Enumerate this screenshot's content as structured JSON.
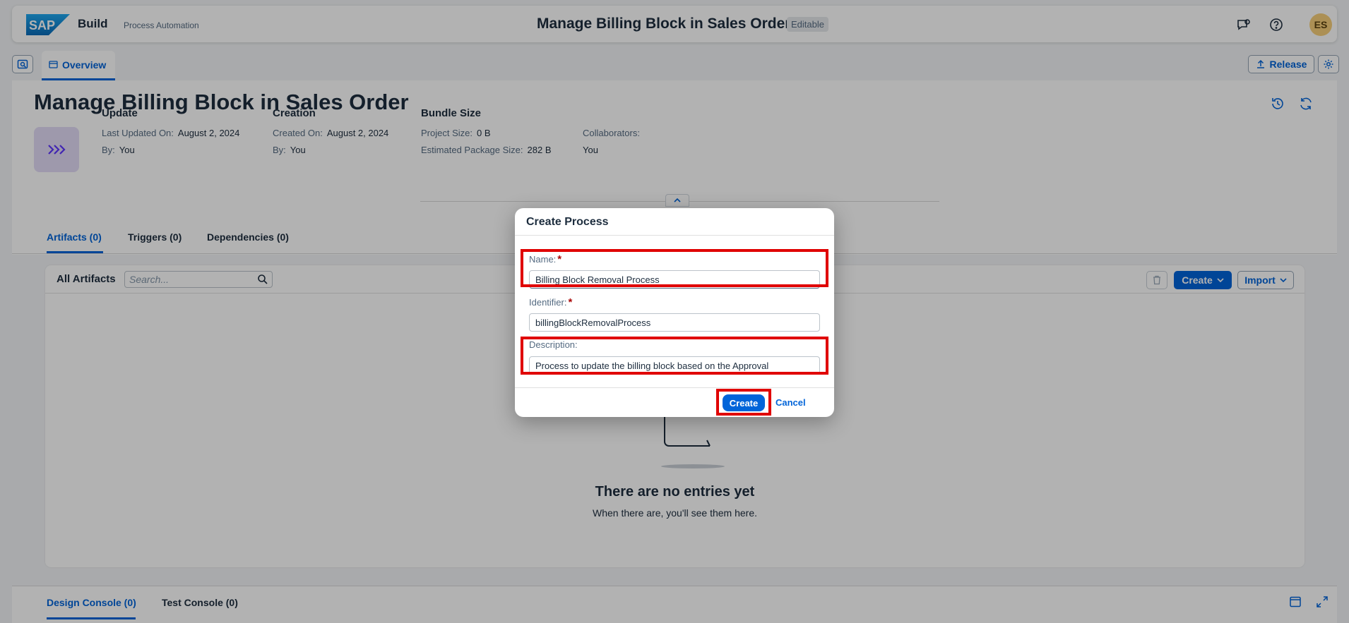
{
  "shell": {
    "logo_text": "SAP",
    "product": "Build",
    "product_sub": "Process Automation",
    "title": "Manage Billing Block in Sales Order",
    "badge": "Editable",
    "avatar_initials": "ES"
  },
  "subheader": {
    "overview_tab": "Overview",
    "release_label": "Release"
  },
  "project": {
    "title": "Manage Billing Block in Sales Order",
    "update": {
      "heading": "Update",
      "last_updated_label": "Last Updated On:",
      "last_updated_value": "August 2, 2024",
      "by_label": "By:",
      "by_value": "You"
    },
    "creation": {
      "heading": "Creation",
      "created_label": "Created On:",
      "created_value": "August 2, 2024",
      "by_label": "By:",
      "by_value": "You"
    },
    "bundle": {
      "heading": "Bundle Size",
      "project_size_label": "Project Size:",
      "project_size_value": "0 B",
      "package_size_label": "Estimated Package Size:",
      "package_size_value": "282 B",
      "collaborators_label": "Collaborators:",
      "collaborators_value": "You"
    }
  },
  "tabs": [
    {
      "label": "Artifacts (0)",
      "active": true
    },
    {
      "label": "Triggers (0)",
      "active": false
    },
    {
      "label": "Dependencies (0)",
      "active": false
    }
  ],
  "artifacts": {
    "title": "All Artifacts",
    "search_placeholder": "Search...",
    "create_label": "Create",
    "import_label": "Import",
    "empty_title": "There are no entries yet",
    "empty_sub": "When there are, you'll see them here."
  },
  "console_tabs": [
    {
      "label": "Design Console (0)",
      "active": true
    },
    {
      "label": "Test Console (0)",
      "active": false
    }
  ],
  "dialog": {
    "title": "Create Process",
    "name_label": "Name:",
    "name_value": "Billing Block Removal Process",
    "identifier_label": "Identifier:",
    "identifier_value": "billingBlockRemovalProcess",
    "description_label": "Description:",
    "description_value": "Process to update the billing block based on the Approval",
    "required_mark": "*",
    "create_label": "Create",
    "cancel_label": "Cancel"
  },
  "colors": {
    "accent": "#0064d9",
    "highlight": "#e00000",
    "required": "#aa0808"
  }
}
